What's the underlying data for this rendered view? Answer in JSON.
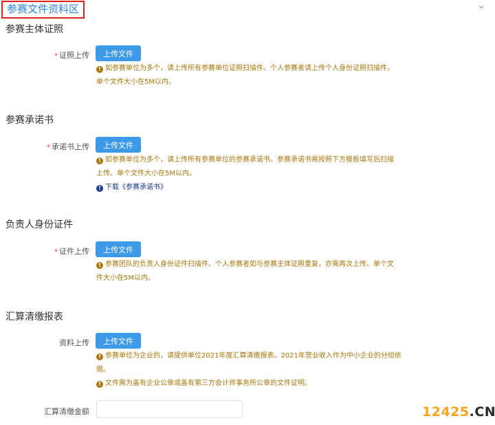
{
  "header": {
    "title": "参赛文件资料区"
  },
  "sections": [
    {
      "title": "参赛主体证照",
      "field_label": "证照上传",
      "required": "*",
      "button": "上传文件",
      "notes": [
        "如参赛单位为多个，请上传所有参赛单位证照扫描件。个人参赛者请上传个人身份证照扫描件。",
        "单个文件大小在5M以内。"
      ]
    },
    {
      "title": "参赛承诺书",
      "field_label": "承诺书上传",
      "required": "*",
      "button": "上传文件",
      "notes": [
        "如参赛单位为多个，请上传所有参赛单位的参赛承诺书。参赛承诺书需按照下方模板填写后扫描",
        "上传。单个文件大小在5M以内。"
      ],
      "download_link": "下载《参赛承诺书》"
    },
    {
      "title": "负责人身份证件",
      "field_label": "证件上传",
      "required": "*",
      "button": "上传文件",
      "notes": [
        "参赛团队的负责人身份证件扫描件。个人参赛者如与参赛主体证照重复，亦需再次上传。单个文",
        "件大小在5M以内。"
      ]
    },
    {
      "title": "汇算清缴报表",
      "field_label": "资料上传",
      "button": "上传文件",
      "notes": [
        "参赛单位为企业的，请提供单位2021年度汇算清缴报表。2021年营业收入作为中小企业的分组依",
        "据。"
      ],
      "notes2": "文件需为盖有企业公章或盖有第三方会计师事务所公章的文件证明。",
      "amount_label": "汇算清缴金额",
      "amount_value": ""
    }
  ],
  "warn_glyph": "!",
  "watermark": {
    "digits": "12425",
    "dot": ".",
    "suffix": "CN"
  },
  "colors": {
    "accent": "#3d9ae8",
    "title_blue": "#2e86de",
    "note": "#a8780e",
    "link": "#1e3a8a",
    "required": "#e03a3a",
    "highlight_border": "#e02020"
  }
}
